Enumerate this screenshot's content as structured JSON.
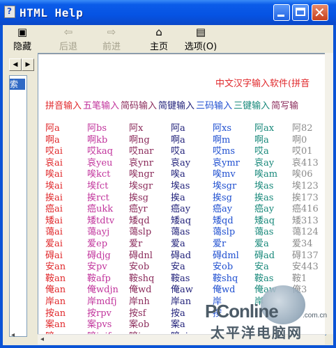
{
  "window": {
    "title": "HTML Help"
  },
  "toolbar": {
    "hide": "隐藏",
    "back": "后退",
    "forward": "前进",
    "home": "主页",
    "options": "选项(O)"
  },
  "nav": {
    "tab_index": "索引"
  },
  "content": {
    "heading": "中文汉字输入软件(拼音",
    "headers": [
      {
        "text": "拼音输入",
        "color": "#e0282b"
      },
      {
        "text": "五笔输入",
        "color": "#c1349c"
      },
      {
        "text": "简码输入",
        "color": "#8a2a5a"
      },
      {
        "text": "简键输入",
        "color": "#1e1e78"
      },
      {
        "text": "三码输入",
        "color": "#1f4fd0"
      },
      {
        "text": "三键输入",
        "color": "#17887a"
      },
      {
        "text": "简写输",
        "color": "#8a2a5a"
      }
    ],
    "rows": [
      [
        "阿a",
        "阿bs",
        "阿x",
        "阿a",
        "阿xs",
        "阿ax",
        "阿82"
      ],
      [
        "啊a",
        "啊kb",
        "啊ng",
        "啊a",
        "啊m",
        "啊a",
        "啊0"
      ],
      [
        "哎ai",
        "哎kaq",
        "哎nar",
        "哎a",
        "哎ms",
        "哎a",
        "哎01"
      ],
      [
        "哀ai",
        "哀yeu",
        "哀ynr",
        "哀ay",
        "哀ymr",
        "哀ay",
        "哀413"
      ],
      [
        "唉ai",
        "唉kct",
        "唉ngr",
        "唉a",
        "唉mv",
        "唉am",
        "唉06"
      ],
      [
        "埃ai",
        "埃fct",
        "埃sgr",
        "埃as",
        "埃sgr",
        "埃as",
        "埃123"
      ],
      [
        "挨ai",
        "挨rct",
        "挨sg",
        "挨a",
        "挨sg",
        "挨as",
        "挨173"
      ],
      [
        "癌ai",
        "癌ukk",
        "癌yr",
        "癌ay",
        "癌ay",
        "癌ay",
        "癌416"
      ],
      [
        "矮ai",
        "矮tdtv",
        "矮qd",
        "矮aq",
        "矮qd",
        "矮aq",
        "矮313"
      ],
      [
        "蔼ai",
        "蔼ayj",
        "蔼slp",
        "蔼as",
        "蔼slp",
        "蔼as",
        "蔼124"
      ],
      [
        "爱ai",
        "爱ep",
        "爱r",
        "爱a",
        "爱r",
        "爱a",
        "爱34"
      ],
      [
        "碍ai",
        "碍djg",
        "碍dnl",
        "碍ad",
        "碍dml",
        "碍ad",
        "碍137"
      ],
      [
        "安an",
        "安pv",
        "安ob",
        "安a",
        "安ob",
        "安a",
        "安443"
      ],
      [
        "鞍an",
        "鞍afp",
        "鞍shq",
        "鞍as",
        "鞍shq",
        "鞍as",
        "鞍1"
      ],
      [
        "俺an",
        "俺wdjn",
        "俺wd",
        "俺aw",
        "俺wd",
        "俺aw",
        "俺3"
      ],
      [
        "岸an",
        "岸mdfj",
        "岸nh",
        "岸an",
        "岸",
        "岸",
        ""
      ],
      [
        "按an",
        "按rpv",
        "按sf",
        "按a",
        "按",
        "",
        ""
      ],
      [
        "案an",
        "案pvs",
        "案ob",
        "案a",
        "",
        "",
        ""
      ],
      [
        "暗an",
        "暗jujf",
        "暗jv",
        "暗aj",
        "",
        "",
        ""
      ],
      [
        "胺an",
        "胺epv",
        "胺tag",
        "胺at",
        "",
        "",
        ""
      ]
    ]
  },
  "watermark": {
    "brand": "PConline",
    "domain": ".com.cn",
    "cn": "太平洋电脑网"
  }
}
